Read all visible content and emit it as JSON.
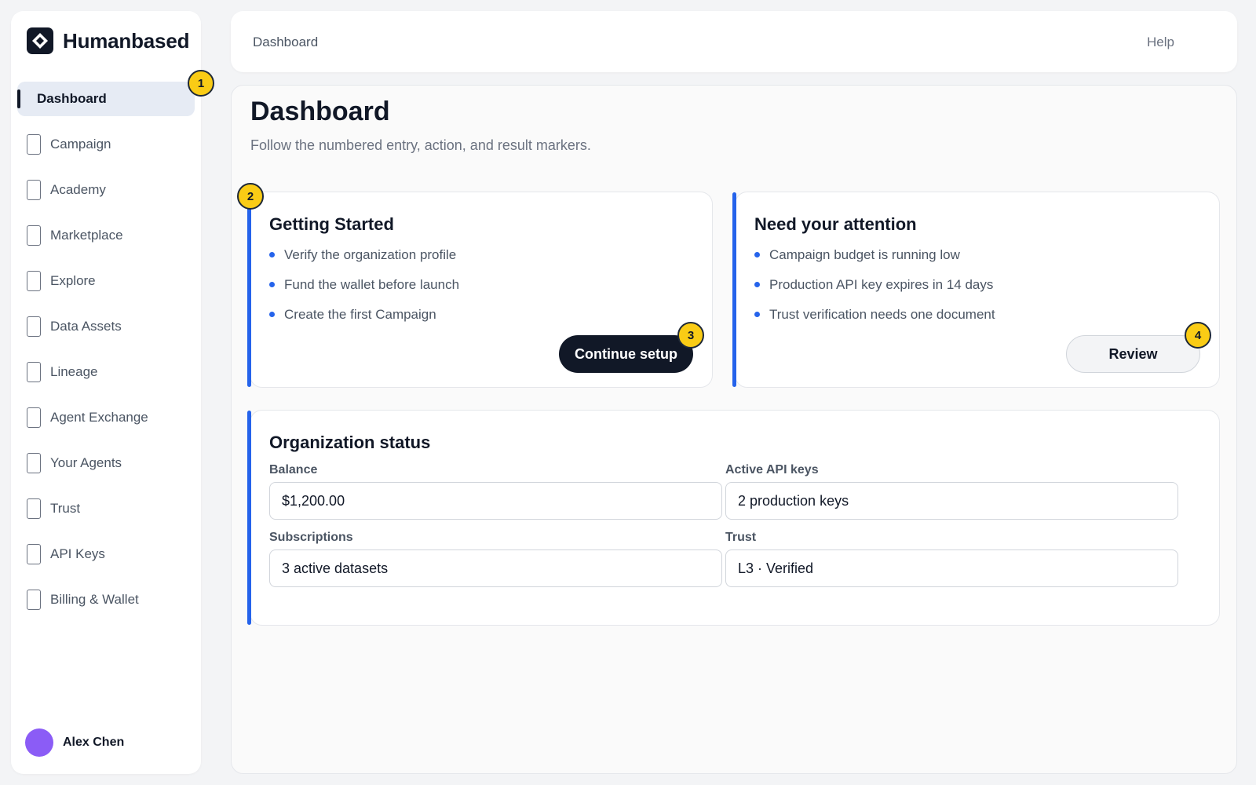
{
  "brand": {
    "name": "Humanbased",
    "logo_icon": "diamond-logo-icon"
  },
  "sidebar": {
    "items": [
      {
        "label": "Dashboard",
        "active": true
      },
      {
        "label": "Campaign"
      },
      {
        "label": "Academy"
      },
      {
        "label": "Marketplace"
      },
      {
        "label": "Explore"
      },
      {
        "label": "Data Assets"
      },
      {
        "label": "Lineage"
      },
      {
        "label": "Agent Exchange"
      },
      {
        "label": "Your Agents"
      },
      {
        "label": "Trust"
      },
      {
        "label": "API Keys"
      },
      {
        "label": "Billing & Wallet"
      }
    ],
    "user": {
      "name": "Alex Chen",
      "avatar_color": "#8b5cf6"
    }
  },
  "topbar": {
    "title": "Dashboard",
    "help": "Help"
  },
  "main": {
    "title": "Dashboard",
    "subtitle": "Follow the numbered entry, action, and result markers.",
    "getting_started": {
      "title": "Getting Started",
      "items": [
        "Verify the organization profile",
        "Fund the wallet before launch",
        "Create the first Campaign"
      ],
      "button": "Continue setup"
    },
    "attention": {
      "title": "Need your attention",
      "items": [
        "Campaign budget is running low",
        "Production API key expires in 14 days",
        "Trust verification needs one document"
      ],
      "button": "Review"
    },
    "org_status": {
      "title": "Organization status",
      "fields": [
        {
          "label": "Balance",
          "value": "$1,200.00"
        },
        {
          "label": "Active API keys",
          "value": "2 production keys"
        },
        {
          "label": "Subscriptions",
          "value": "3 active datasets"
        },
        {
          "label": "Trust",
          "value": "L3 · Verified"
        }
      ]
    }
  },
  "markers": [
    "1",
    "2",
    "3",
    "4"
  ],
  "colors": {
    "accent": "#2563eb",
    "marker": "#facc15",
    "primary_button": "#111827"
  }
}
